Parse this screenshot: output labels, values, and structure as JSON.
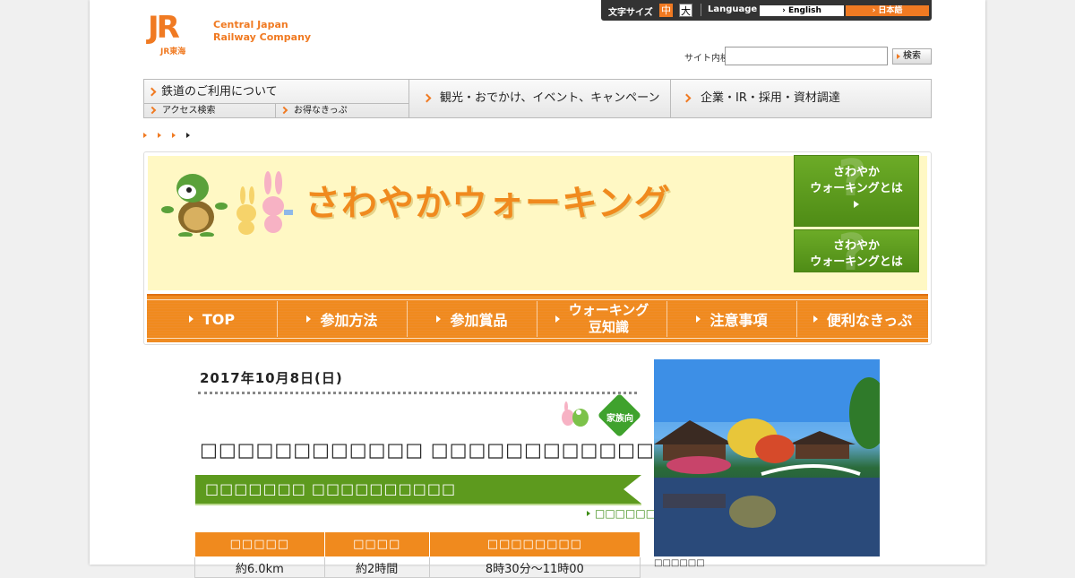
{
  "header": {
    "logo_mark": "JR",
    "logo_sub": "JR東海",
    "company_line1": "Central Japan",
    "company_line2": "Railway Company",
    "font_size_label": "文字サイズ",
    "font_mid": "中",
    "font_big": "大",
    "language_label": "Language",
    "lang_en": "English",
    "lang_ja": "日本語",
    "search_label": "サイト内検索",
    "search_value": "",
    "search_button": "検索"
  },
  "global_nav": {
    "rail": "鉄道のご利用について",
    "access": "アクセス検索",
    "tickets": "お得なきっぷ",
    "tourism": "観光・おでかけ、イベント、キャンペーン",
    "corporate": "企業・IR・採用・資材調達"
  },
  "banner": {
    "title": "さわやかウォーキング",
    "side_button_1_line1": "さわやか",
    "side_button_1_line2": "ウォーキングとは",
    "side_button_2_line1": "さわやか",
    "side_button_2_line2": "ウォーキングとは"
  },
  "local_nav": [
    {
      "label": "TOP"
    },
    {
      "label": "参加方法"
    },
    {
      "label": "参加賞品"
    },
    {
      "label_line1": "ウォーキング",
      "label_line2": "豆知識"
    },
    {
      "label": "注意事項"
    },
    {
      "label": "便利なきっぷ"
    }
  ],
  "event": {
    "date": "2017年10月8日(日)",
    "family_badge": "家族向",
    "title": "□□□□□□□□□□□□ □□□□□□□□□□□□□□",
    "course": "□□□□□□□ □□□□□□□□□□",
    "more_link": "□□□□□□□□",
    "table_headers": [
      "□□□□□",
      "□□□□",
      "□□□□□□□□"
    ],
    "table_row": [
      "約6.0km",
      "約2時間",
      "8時30分～11時00"
    ],
    "photo_caption": "□□□□□□"
  },
  "colors": {
    "jr_orange": "#f07a22",
    "nav_orange": "#f08a1e",
    "walking_green": "#5d9a1e",
    "banner_cream": "#fff8c4"
  }
}
